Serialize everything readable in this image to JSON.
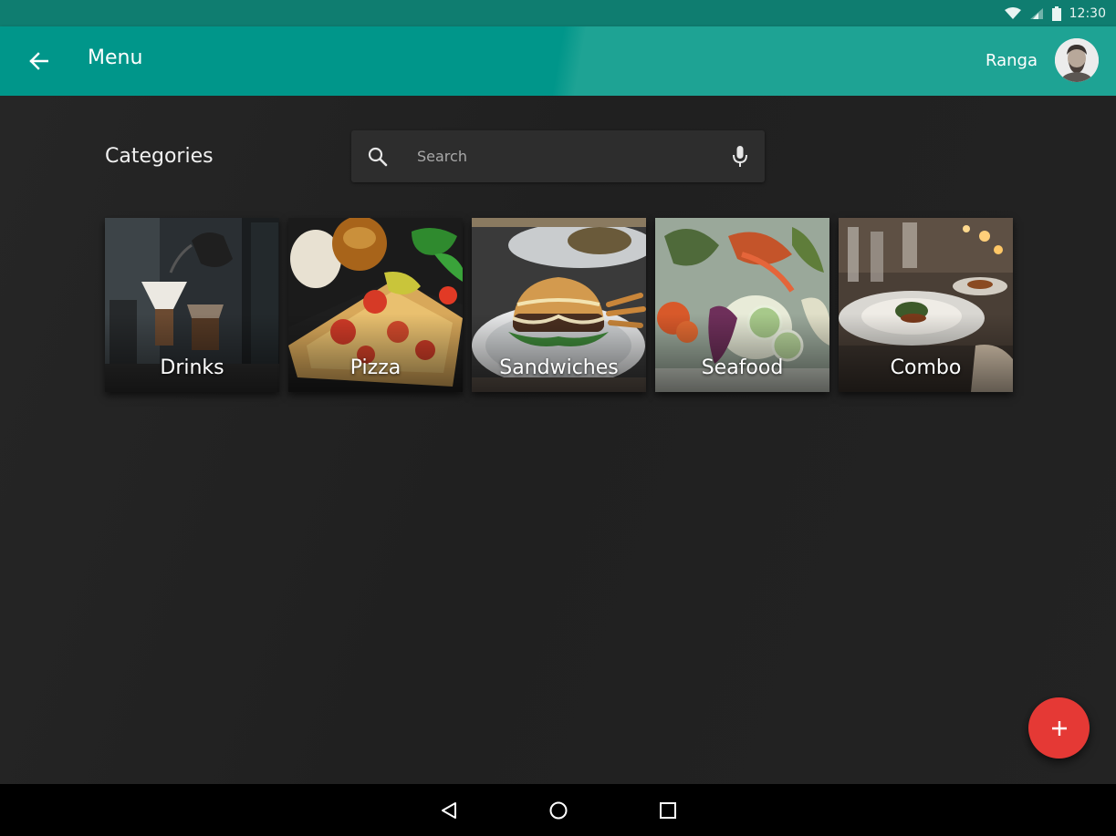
{
  "status_bar": {
    "time": "12:30",
    "icons": [
      "wifi-icon",
      "cell-signal-icon",
      "battery-icon"
    ]
  },
  "app_bar": {
    "title": "Menu",
    "back_icon": "arrow-back-icon",
    "user_name": "Ranga",
    "avatar_icon": "user-avatar"
  },
  "main": {
    "section_title": "Categories",
    "search": {
      "placeholder": "Search",
      "value": "",
      "search_icon": "search-icon",
      "mic_icon": "mic-icon"
    },
    "categories": [
      {
        "label": "Drinks"
      },
      {
        "label": "Pizza"
      },
      {
        "label": "Sandwiches"
      },
      {
        "label": "Seafood"
      },
      {
        "label": "Combo"
      }
    ]
  },
  "fab": {
    "icon": "plus-icon",
    "color": "#e53935"
  },
  "nav_bar": {
    "icons": [
      "nav-back-icon",
      "nav-home-icon",
      "nav-recents-icon"
    ]
  },
  "colors": {
    "primary": "#00968a",
    "status": "#0f7d70",
    "background": "#212121",
    "accent": "#e53935"
  }
}
